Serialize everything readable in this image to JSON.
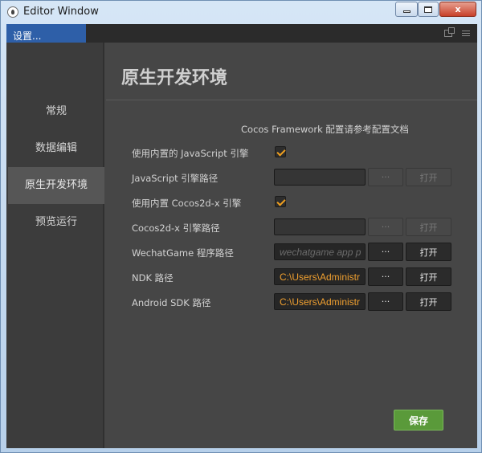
{
  "window": {
    "title": "Editor Window",
    "close_glyph": "x"
  },
  "tab": {
    "label": "设置..."
  },
  "sidebar": {
    "items": [
      {
        "label": "常规"
      },
      {
        "label": "数据编辑"
      },
      {
        "label": "原生开发环境",
        "active": true
      },
      {
        "label": "预览运行"
      }
    ]
  },
  "main": {
    "heading": "原生开发环境",
    "note": "Cocos Framework 配置请参考配置文档",
    "rows": [
      {
        "label": "使用内置的 JavaScript 引擎",
        "type": "checkbox",
        "checked": true
      },
      {
        "label": "JavaScript 引擎路径",
        "type": "path",
        "value": "",
        "enabled": false,
        "browse": "···",
        "open": "打开"
      },
      {
        "label": "使用内置 Cocos2d-x 引擎",
        "type": "checkbox",
        "checked": true
      },
      {
        "label": "Cocos2d-x 引擎路径",
        "type": "path",
        "value": "",
        "enabled": false,
        "browse": "···",
        "open": "打开"
      },
      {
        "label": "WechatGame 程序路径",
        "type": "path",
        "value": "",
        "placeholder": "wechatgame app p",
        "enabled": true,
        "browse": "···",
        "open": "打开"
      },
      {
        "label": "NDK 路径",
        "type": "path",
        "value": "C:\\Users\\Administr",
        "enabled": true,
        "browse": "···",
        "open": "打开"
      },
      {
        "label": "Android SDK 路径",
        "type": "path",
        "value": "C:\\Users\\Administr",
        "enabled": true,
        "browse": "···",
        "open": "打开"
      }
    ],
    "save_label": "保存"
  },
  "colors": {
    "accent_orange": "#f0a030",
    "tab_blue": "#2e5fa8",
    "save_green": "#5a9a3a",
    "panel_bg": "#464646"
  }
}
